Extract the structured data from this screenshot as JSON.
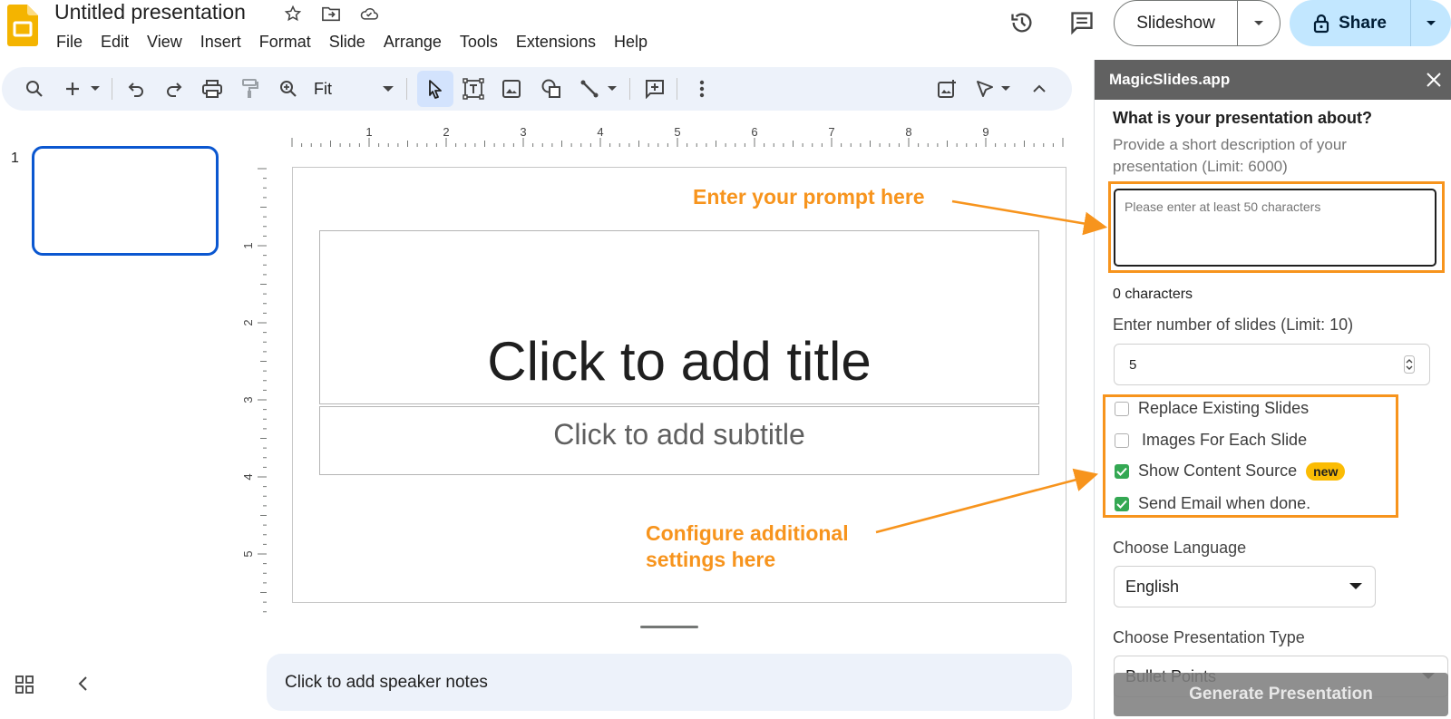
{
  "document": {
    "title": "Untitled presentation"
  },
  "menu": [
    "File",
    "Edit",
    "View",
    "Insert",
    "Format",
    "Slide",
    "Arrange",
    "Tools",
    "Extensions",
    "Help"
  ],
  "header": {
    "slideshow_label": "Slideshow",
    "share_label": "Share"
  },
  "toolbar": {
    "zoom_value": "Fit"
  },
  "filmstrip": {
    "slide_number": "1"
  },
  "ruler": {
    "horizontal": [
      "1",
      "2",
      "3",
      "4",
      "5",
      "6",
      "7",
      "8",
      "9"
    ],
    "vertical": [
      "1",
      "2",
      "3",
      "4",
      "5"
    ]
  },
  "slide": {
    "title_placeholder": "Click to add title",
    "subtitle_placeholder": "Click to add subtitle"
  },
  "notes": {
    "placeholder": "Click to add speaker notes"
  },
  "annotations": {
    "prompt": "Enter your prompt here",
    "settings_line1": "Configure additional",
    "settings_line2": "settings here",
    "color": "#f7941d"
  },
  "panel": {
    "title": "MagicSlides.app",
    "question": "What is your presentation about?",
    "description": "Provide a short description of your presentation (Limit: 6000)",
    "prompt_placeholder": "Please enter at least 50 characters",
    "char_count": "0 characters",
    "slides_label": "Enter number of slides (Limit: 10)",
    "slides_value": "5",
    "options": [
      {
        "label": "Replace Existing Slides",
        "checked": false
      },
      {
        "label": "Images For Each Slide",
        "checked": false
      },
      {
        "label": "Show Content Source",
        "checked": true,
        "badge": "new"
      },
      {
        "label": "Send Email when done.",
        "checked": true
      }
    ],
    "language_label": "Choose Language",
    "language_value": "English",
    "type_label": "Choose Presentation Type",
    "type_value": "Bullet Points",
    "generate_label": "Generate Presentation"
  },
  "colors": {
    "accent_blue": "#0b57d0",
    "share_bg": "#c2e7ff",
    "toolbar_bg": "#edf2fa",
    "panel_header": "#616161",
    "checkbox_green": "#34a853",
    "badge_yellow": "#fbbc04"
  }
}
